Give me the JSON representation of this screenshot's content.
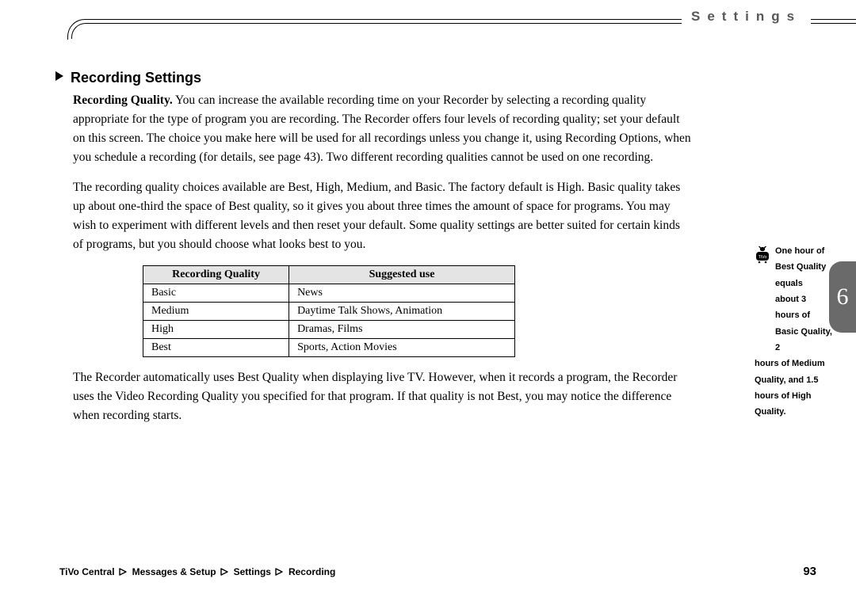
{
  "section_label": "Settings",
  "chapter_number": "6",
  "heading": "Recording Settings",
  "lead_in": "Recording Quality.",
  "para1_rest": " You can increase the available recording time on your Recorder by selecting a recording quality appropriate for the type of program you are recording. The Recorder offers four levels of recording quality; set your default on this screen. The choice you make here will be used for all recordings unless you change it, using Recording Options, when you schedule a recording (for details, see page 43). Two different recording qualities cannot be used on one recording.",
  "para2": "The recording quality choices available are Best, High, Medium, and Basic. The factory default is High. Basic quality takes up about one-third the space of Best quality, so it gives you about three times the amount of space for programs. You may wish to experiment with different levels and then reset your default. Some quality settings are better suited for certain kinds of programs, but you should choose what looks best to you.",
  "table": {
    "headers": [
      "Recording Quality",
      "Suggested use"
    ],
    "rows": [
      [
        "Basic",
        "News"
      ],
      [
        "Medium",
        "Daytime Talk Shows, Animation"
      ],
      [
        "High",
        "Dramas, Films"
      ],
      [
        "Best",
        "Sports, Action Movies"
      ]
    ]
  },
  "para3": "The Recorder automatically uses Best Quality when displaying live TV. However, when it records a program, the Recorder uses the Video Recording Quality you specified for that program. If that quality is not Best, you may notice the difference when recording starts.",
  "margin_note_line1": "One hour of Best Quality equals",
  "margin_note_line2": "about 3 hours of Basic Quality, 2",
  "margin_note_rest": "hours of Medium Quality, and 1.5 hours of High Quality.",
  "breadcrumb": [
    "TiVo Central",
    "Messages & Setup",
    "Settings",
    "Recording"
  ],
  "page_number": "93"
}
